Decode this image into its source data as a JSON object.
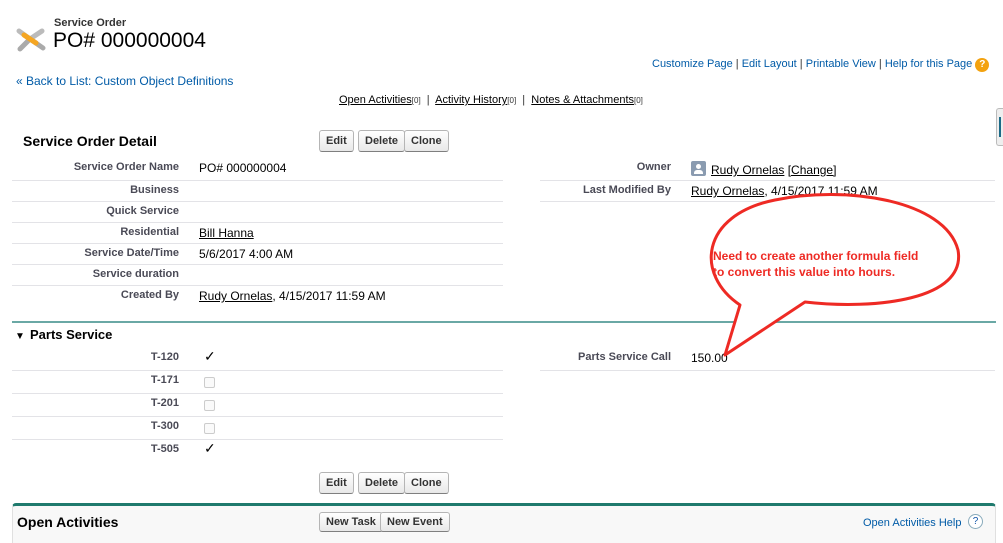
{
  "header": {
    "object_type": "Service Order",
    "title": "PO# 000000004",
    "back_link": "« Back to List: Custom Object Definitions"
  },
  "top_links": [
    "Customize Page",
    "Edit Layout",
    "Printable View",
    "Help for this Page"
  ],
  "related_links": [
    {
      "label": "Open Activities",
      "count": "[0]"
    },
    {
      "label": "Activity History",
      "count": "[0]"
    },
    {
      "label": "Notes & Attachments",
      "count": "[0]"
    }
  ],
  "detail": {
    "title": "Service Order Detail",
    "buttons": {
      "edit": "Edit",
      "delete": "Delete",
      "clone": "Clone"
    },
    "left": [
      {
        "label": "Service Order Name",
        "value": "PO# 000000004"
      },
      {
        "label": "Business",
        "value": ""
      },
      {
        "label": "Quick Service",
        "value": ""
      },
      {
        "label": "Residential",
        "value": "Bill Hanna"
      },
      {
        "label": "Service Date/Time",
        "value": "5/6/2017 4:00 AM"
      },
      {
        "label": "Service duration",
        "value": ""
      },
      {
        "label": "Created By",
        "value": "Rudy Ornelas",
        "suffix": ", 4/15/2017 11:59 AM"
      }
    ],
    "owner": {
      "label": "Owner",
      "name": "Rudy Ornelas",
      "change": "[Change]"
    },
    "last_modified": {
      "label": "Last Modified By",
      "name": "Rudy Ornelas",
      "suffix": ", 4/15/2017 11:59 AM"
    }
  },
  "parts": {
    "title": "Parts Service",
    "items": [
      {
        "label": "T-120",
        "checked": true
      },
      {
        "label": "T-171",
        "checked": false
      },
      {
        "label": "T-201",
        "checked": false
      },
      {
        "label": "T-300",
        "checked": false
      },
      {
        "label": "T-505",
        "checked": true
      }
    ],
    "call": {
      "label": "Parts Service Call",
      "value": "150.00"
    },
    "check_glyph": "✓"
  },
  "annotation": {
    "line1": "Need to create another formula field",
    "line2": "to convert this value into hours.",
    "color": "#ee2a24"
  },
  "open_activities": {
    "title": "Open Activities",
    "new_task": "New Task",
    "new_event": "New Event",
    "help": "Open Activities Help",
    "help_glyph": "?"
  }
}
